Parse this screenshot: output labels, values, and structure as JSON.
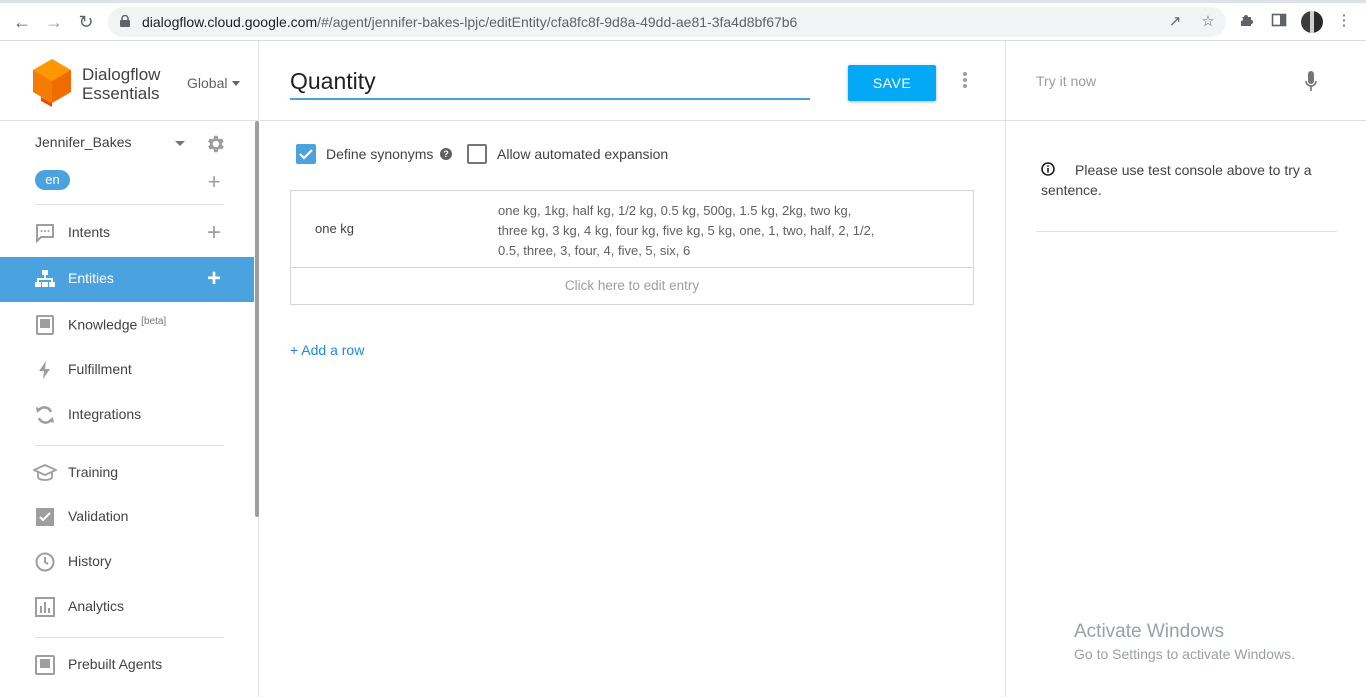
{
  "browser": {
    "url_host": "dialogflow.cloud.google.com",
    "url_path": "/#/agent/jennifer-bakes-lpjc/editEntity/cfa8fc8f-9d8a-49dd-ae81-3fa4d8bf67b6"
  },
  "sidebar": {
    "product_line1": "Dialogflow",
    "product_line2": "Essentials",
    "region": "Global",
    "agent_name": "Jennifer_Bakes",
    "language": "en",
    "items": [
      {
        "label": "Intents",
        "icon": "chat-bubble-icon"
      },
      {
        "label": "Entities",
        "icon": "hierarchy-icon"
      },
      {
        "label": "Knowledge",
        "sup": "[beta]",
        "icon": "book-icon"
      },
      {
        "label": "Fulfillment",
        "icon": "bolt-icon"
      },
      {
        "label": "Integrations",
        "icon": "sync-icon"
      },
      {
        "label": "Training",
        "icon": "graduation-cap-icon"
      },
      {
        "label": "Validation",
        "icon": "check-box-icon"
      },
      {
        "label": "History",
        "icon": "clock-icon"
      },
      {
        "label": "Analytics",
        "icon": "bar-chart-icon"
      },
      {
        "label": "Prebuilt Agents",
        "icon": "prebuilt-agents-icon"
      }
    ],
    "accent_color": "#4aa3df"
  },
  "editor": {
    "entity_name": "Quantity",
    "save_label": "SAVE",
    "define_synonyms_label": "Define synonyms",
    "define_synonyms_checked": true,
    "auto_expansion_label": "Allow automated expansion",
    "auto_expansion_checked": false,
    "entries": [
      {
        "reference_value": "one kg",
        "synonyms": "one kg, 1kg, half kg, 1/2 kg, 0.5 kg, 500g, 1.5 kg, 2kg, two kg, three kg, 3 kg, 4 kg, four kg, five kg, 5 kg, one, 1, two, half, 2, 1/2, 0.5, three, 3, four, 4, five, 5, six, 6"
      }
    ],
    "edit_entry_placeholder": "Click here to edit entry",
    "add_row_label": "+ Add a row"
  },
  "test_console": {
    "placeholder": "Try it now",
    "hint": "Please use test console above to try a sentence."
  },
  "watermark": {
    "line1": "Activate Windows",
    "line2": "Go to Settings to activate Windows."
  }
}
